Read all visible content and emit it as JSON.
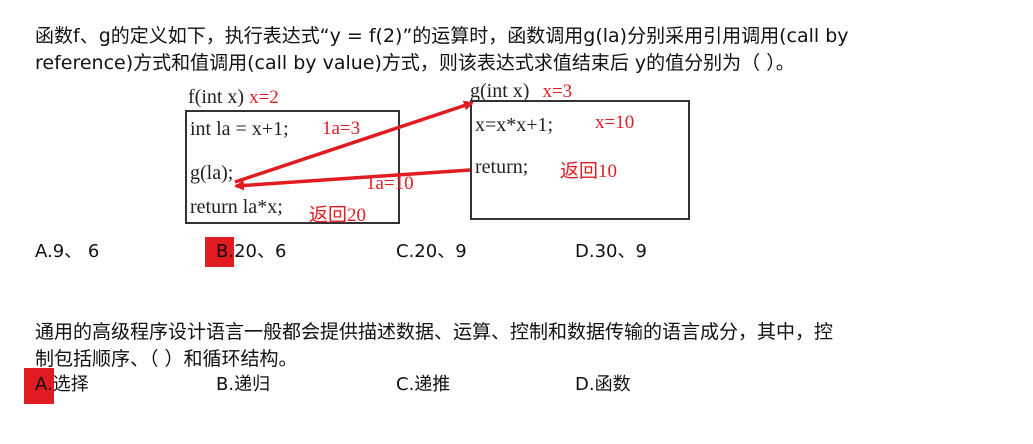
{
  "question1": {
    "line1": "函数f、g的定义如下，执行表达式“y = f(2)”的运算时，函数调用g(la)分别采用引用调用(call by",
    "line2": "reference)方式和值调用(call by value)方式，则该表达式求值结束后 y的值分别为（  ）。",
    "diagram": {
      "f_header": "f(int x)",
      "f_header_note": "x=2",
      "f_line1": "int la = x+1;",
      "f_line1_note": "1a=3",
      "f_line2": "g(la);",
      "f_line3": "return la*x;",
      "f_line3_note": "返回20",
      "g_header": "g(int x)",
      "g_header_note": "x=3",
      "g_line1": "x=x*x+1;",
      "g_line1_note": "x=10",
      "g_line2": "return;",
      "g_line2_note": "返回10",
      "arrow_note": "1a=10"
    },
    "options": [
      {
        "letter": "A.",
        "text": "9、 6",
        "selected": false
      },
      {
        "letter": "B.",
        "text": "20、6",
        "selected": true
      },
      {
        "letter": "C.",
        "text": "20、9",
        "selected": false
      },
      {
        "letter": "D.",
        "text": "30、9",
        "selected": false
      }
    ]
  },
  "question2": {
    "line1": "通用的高级程序设计语言一般都会提供描述数据、运算、控制和数据传输的语言成分，其中，控",
    "line2": "制包括顺序、（  ）和循环结构。",
    "options": [
      {
        "letter": "A.",
        "text": "选择",
        "selected": true
      },
      {
        "letter": "B.",
        "text": "递归",
        "selected": false
      },
      {
        "letter": "C.",
        "text": "递推",
        "selected": false
      },
      {
        "letter": "D.",
        "text": "函数",
        "selected": false
      }
    ]
  },
  "colors": {
    "highlight": "#e11b22",
    "text": "#111111",
    "arrow": "#e11b22"
  }
}
